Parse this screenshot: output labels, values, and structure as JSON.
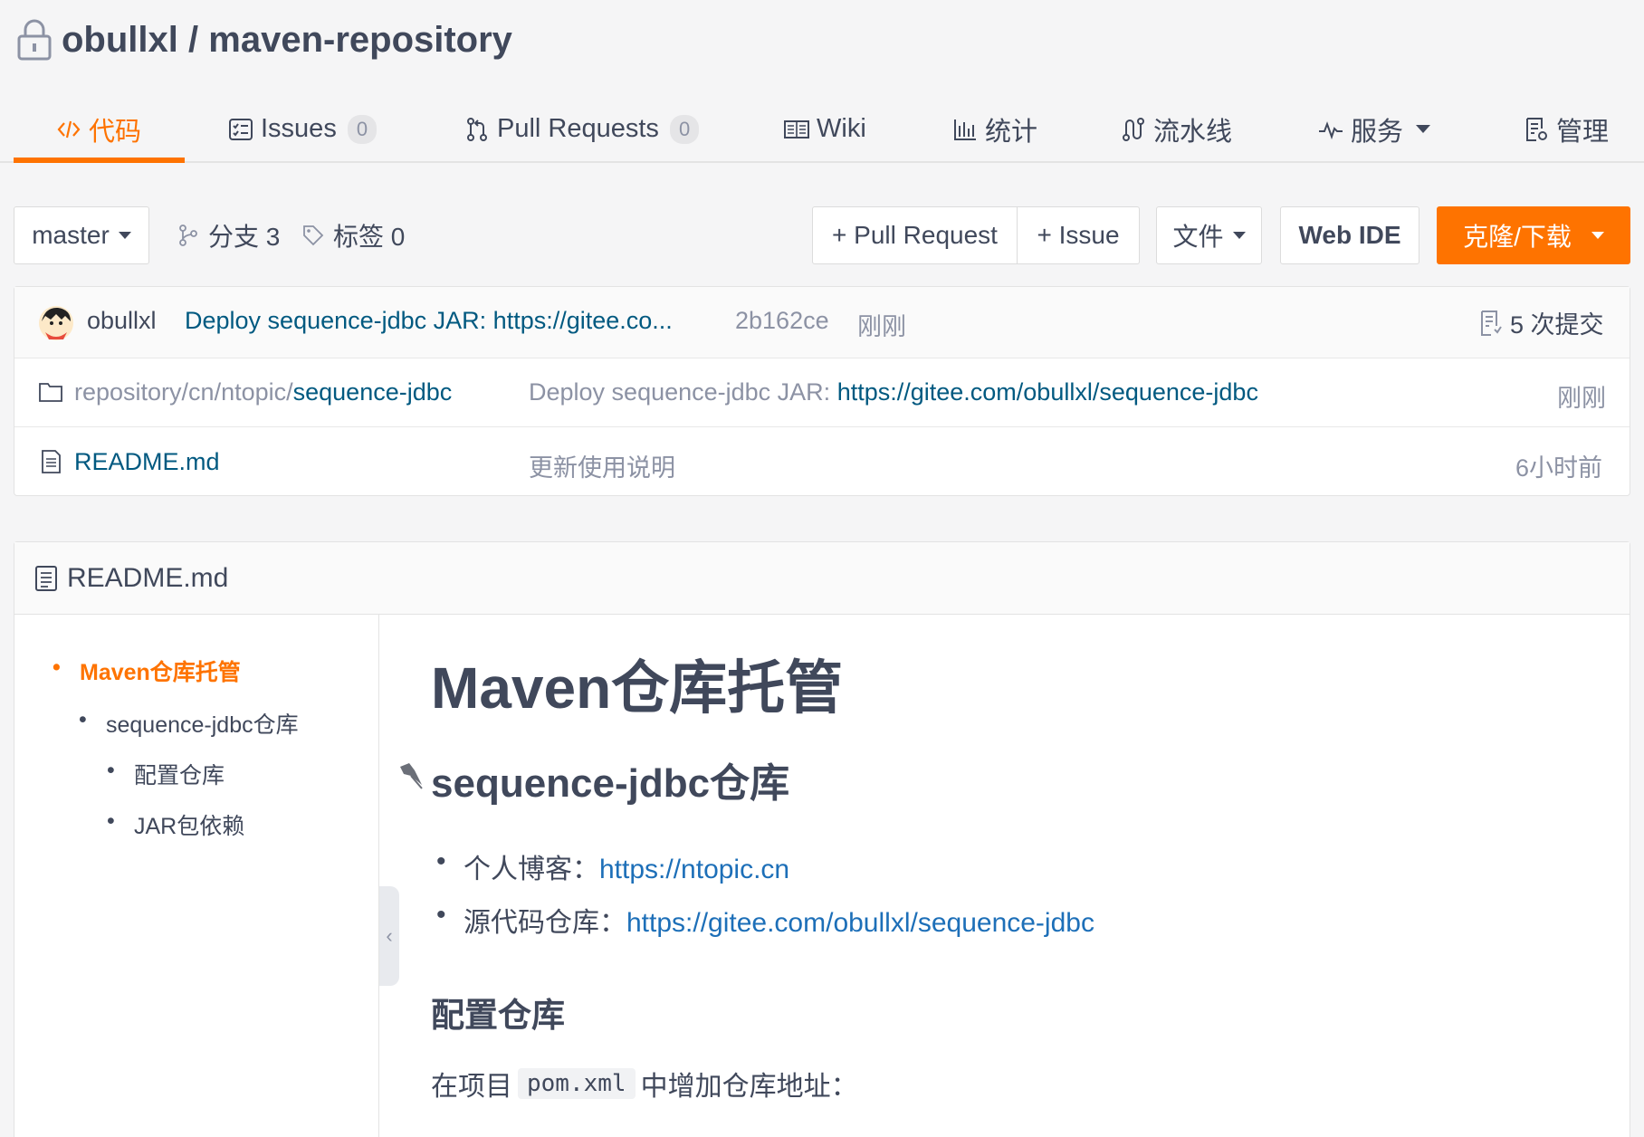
{
  "repo": {
    "owner": "obullxl",
    "separator": "/",
    "name": "maven-repository"
  },
  "tabs": [
    {
      "label": "代码",
      "active": true
    },
    {
      "label": "Issues",
      "count": "0"
    },
    {
      "label": "Pull Requests",
      "count": "0"
    },
    {
      "label": "Wiki"
    },
    {
      "label": "统计"
    },
    {
      "label": "流水线"
    },
    {
      "label": "服务"
    },
    {
      "label": "管理"
    }
  ],
  "toolbar": {
    "branch": "master",
    "branches_label": "分支 3",
    "tags_label": "标签 0",
    "pull_request_button": "+ Pull Request",
    "issue_button": "+ Issue",
    "file_button": "文件",
    "web_ide_button": "Web IDE",
    "clone_button": "克隆/下载"
  },
  "last_commit": {
    "author": "obullxl",
    "message": "Deploy sequence-jdbc JAR: https://gitee.co...",
    "hash": "2b162ce",
    "time": "刚刚",
    "commits_label": "5 次提交"
  },
  "files": [
    {
      "path_prefix": "repository/cn/ntopic/",
      "name": "sequence-jdbc",
      "message_prefix": "Deploy sequence-jdbc JAR: ",
      "message_link": "https://gitee.com/obullxl/sequence-jdbc",
      "time": "刚刚",
      "icon": "folder-icon"
    },
    {
      "name": "README.md",
      "message": "更新使用说明",
      "time": "6小时前",
      "icon": "file-text-icon"
    }
  ],
  "readme": {
    "title": "README.md",
    "toc": [
      {
        "label": "Maven仓库托管",
        "level": 1,
        "active": true
      },
      {
        "label": "sequence-jdbc仓库",
        "level": 2
      },
      {
        "label": "配置仓库",
        "level": 3
      },
      {
        "label": "JAR包依赖",
        "level": 3
      }
    ],
    "collapse_glyph": "‹",
    "h1": "Maven仓库托管",
    "h2": "sequence-jdbc仓库",
    "list": [
      {
        "label": "个人博客：",
        "link": "https://ntopic.cn"
      },
      {
        "label": "源代码仓库：",
        "link": "https://gitee.com/obullxl/sequence-jdbc"
      }
    ],
    "h3": "配置仓库",
    "para_before": "在项目",
    "para_code": "pom.xml",
    "para_after": "中增加仓库地址："
  },
  "colors": {
    "accent": "#fe7300",
    "link": "#005980",
    "text": "#40485b"
  }
}
